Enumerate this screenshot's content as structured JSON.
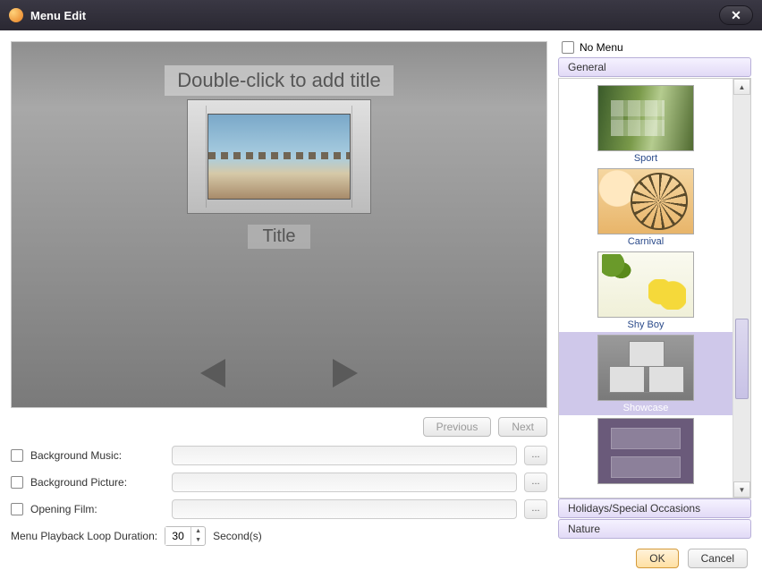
{
  "window": {
    "title": "Menu Edit"
  },
  "preview": {
    "title_placeholder": "Double-click to add title",
    "thumb_title": "Title"
  },
  "nav": {
    "previous": "Previous",
    "next": "Next"
  },
  "options": {
    "bg_music_label": "Background Music:",
    "bg_picture_label": "Background Picture:",
    "opening_film_label": "Opening Film:",
    "loop_label": "Menu Playback Loop Duration:",
    "loop_value": "30",
    "loop_unit": "Second(s)",
    "browse": "..."
  },
  "right": {
    "no_menu": "No Menu",
    "categories": {
      "general": "General",
      "holidays": "Holidays/Special Occasions",
      "nature": "Nature"
    },
    "templates": [
      {
        "label": "Sport"
      },
      {
        "label": "Carnival"
      },
      {
        "label": "Shy Boy"
      },
      {
        "label": "Showcase"
      },
      {
        "label": ""
      }
    ]
  },
  "footer": {
    "ok": "OK",
    "cancel": "Cancel"
  }
}
